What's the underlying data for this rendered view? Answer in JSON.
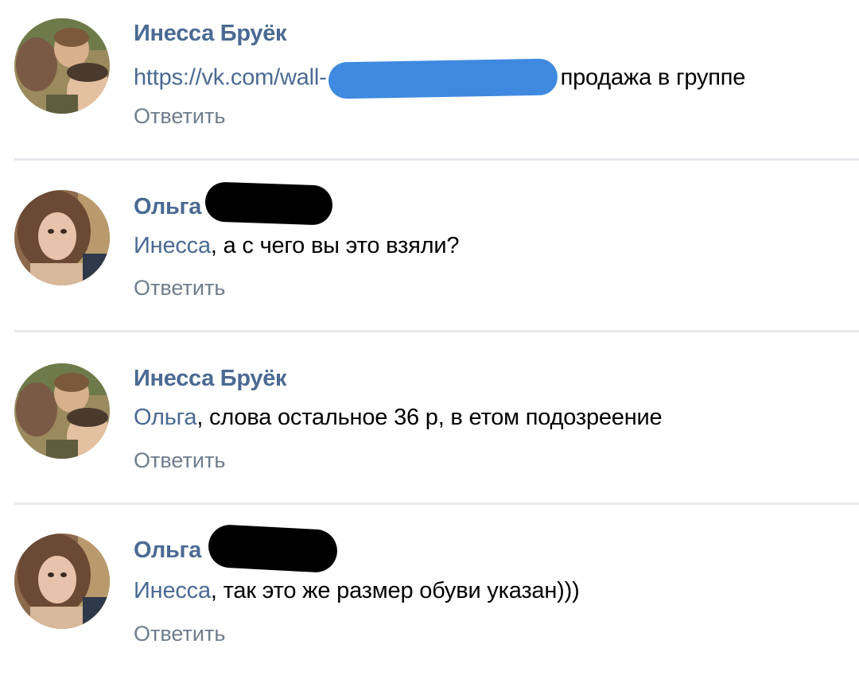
{
  "comments": [
    {
      "author": "Инесса Бруёк",
      "link_prefix": "https://vk.com/wall-",
      "text_after": "продажа в группе",
      "reply": "Ответить"
    },
    {
      "author": "Ольга",
      "mention": "Инесса",
      "text": ", а с чего вы это взяли?",
      "reply": "Ответить"
    },
    {
      "author": "Инесса Бруёк",
      "mention": "Ольга",
      "text": ", слова остальное 36 р, в етом подозреение",
      "reply": "Ответить"
    },
    {
      "author": "Ольга",
      "mention": "Инесса",
      "text": ", так это же размер обуви указан)))",
      "reply": "Ответить"
    }
  ],
  "colors": {
    "author": "#4a6a93",
    "mention": "#4a6a93",
    "reply": "#6f7d8c",
    "redaction_blue": "#3f8ae0",
    "redaction_black": "#000000",
    "divider": "#e7e8ec"
  }
}
